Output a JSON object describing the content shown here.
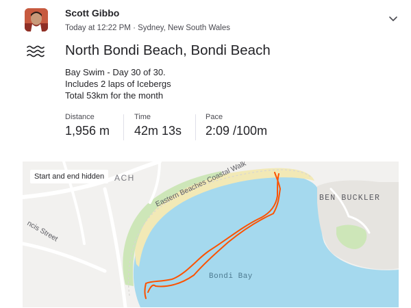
{
  "athlete": {
    "name": "Scott Gibbo",
    "meta": "Today at 12:22 PM · Sydney, New South Wales",
    "avatar_icon": "athlete-avatar"
  },
  "activity": {
    "sport_icon": "swim-icon",
    "title": "North Bondi Beach, Bondi Beach",
    "description": [
      "Bay Swim - Day 30 of 30.",
      "Includes 2 laps of Icebergs",
      "Total 53km for the month"
    ]
  },
  "stats": [
    {
      "label": "Distance",
      "value": "1,956 m"
    },
    {
      "label": "Time",
      "value": "42m 13s"
    },
    {
      "label": "Pace",
      "value": "2:09 /100m"
    }
  ],
  "map": {
    "badge": "Start and end hidden",
    "labels": {
      "north_bondi_fragment": "ACH",
      "coastal_walk": "Eastern Beaches Coastal Walk",
      "ben_buckler": "BEN BUCKLER",
      "francis_street": "ncis Street",
      "bondi_bay": "Bondi Bay"
    },
    "colors": {
      "water": "#a5d9ee",
      "sand": "#f2e9b6",
      "park": "#cde6b8",
      "land": "#f2f1ef",
      "road": "#ffffff",
      "route": "#fc5200"
    }
  },
  "header": {
    "chevron_icon": "chevron-down-icon"
  }
}
